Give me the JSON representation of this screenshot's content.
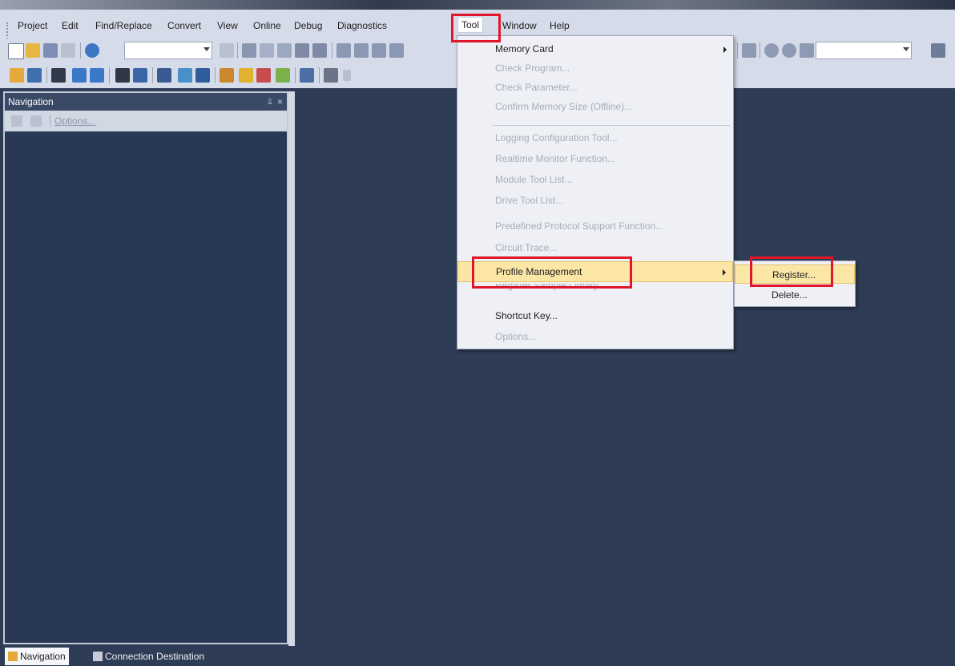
{
  "menubar": {
    "items": [
      "Project",
      "Edit",
      "Find/Replace",
      "Convert",
      "View",
      "Online",
      "Debug",
      "Diagnostics",
      "Tool",
      "Window",
      "Help"
    ],
    "active": "Tool"
  },
  "navigation": {
    "title": "Navigation",
    "pin_glyph": "⫫",
    "close_glyph": "×",
    "toolbar_options": "Options..."
  },
  "bottom_tabs": {
    "navigation": "Navigation",
    "connection": "Connection Destination"
  },
  "tool_menu": {
    "items": [
      {
        "label": "Memory Card",
        "enabled": true,
        "submenu": true
      },
      {
        "label": "Check Program...",
        "enabled": false
      },
      {
        "label": "Check Parameter...",
        "enabled": false
      },
      {
        "label": "Confirm Memory Size (Offline)...",
        "enabled": false
      },
      {
        "label": "Logging Configuration Tool...",
        "enabled": false
      },
      {
        "label": "Realtime Monitor Function...",
        "enabled": false
      },
      {
        "label": "Module Tool List...",
        "enabled": false
      },
      {
        "label": "Drive Tool List...",
        "enabled": false
      },
      {
        "label": "Predefined Protocol Support Function...",
        "enabled": false
      },
      {
        "label": "Circuit Trace...",
        "enabled": false
      },
      {
        "label": "Profile Management",
        "enabled": true,
        "submenu": true,
        "highlighted": true
      },
      {
        "label": "Register Sample Library...",
        "enabled": false
      },
      {
        "label": "Shortcut Key...",
        "enabled": true
      },
      {
        "label": "Options...",
        "enabled": false
      }
    ]
  },
  "profile_submenu": {
    "items": [
      {
        "label": "Register...",
        "highlighted": true
      },
      {
        "label": "Delete..."
      }
    ]
  },
  "colors": {
    "accent_red": "#e0172a",
    "workspace": "#2f3c55",
    "menu_highlight": "#fbe6a6"
  }
}
